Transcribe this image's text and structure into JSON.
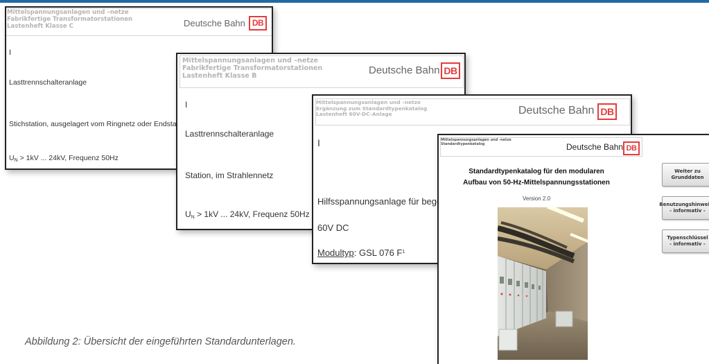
{
  "caption": "Abbildung 2: Übersicht der eingeführten Standardunterlagen.",
  "brand_name": "Deutsche Bahn",
  "logo_text": "DB",
  "doc_c": {
    "header_lines": [
      "Mittelspannungsanlagen und –netze",
      "Fabrikfertige Transformatorstationen",
      "Lastenheft Klasse C"
    ],
    "roman": "I",
    "line1": "Lasttrennschalteranlage",
    "line2": "Stichstation, ausgelagert vom Ringnetz oder Endstation",
    "line3_pre": "U",
    "line3_sub": "N",
    "line3_post": " > 1kV ... 24kV, Frequenz 50Hz"
  },
  "doc_b": {
    "header_lines": [
      "Mittelspannungsanlagen und –netze",
      "Fabrikfertige Transformatorstationen",
      "Lastenheft Klasse B"
    ],
    "roman": "I",
    "line1": "Lasttrennschalteranlage",
    "line2": "Station, im Strahlennetz",
    "line3_pre": "U",
    "line3_sub": "N",
    "line3_post": " > 1kV ... 24kV, Frequenz 50Hz"
  },
  "doc_dc": {
    "header_lines": [
      "Mittelspannungsanlagen und –netze",
      "Ergänzung zum Standardtypenkatalog",
      "Lastenheft 60V-DC-Anlage"
    ],
    "roman": "I",
    "line1": "Hilfsspannungsanlage für begehbare Stationen",
    "line2": "60V DC",
    "line3_label": "Modultyp",
    "line3_value": ": GSL 076 F",
    "line3_sup": "1"
  },
  "doc_cat": {
    "header_lines": [
      "Mittelspannungsanlagen und -netze",
      "Standardtypenkatalog"
    ],
    "title_lines": [
      "Standardtypenkatalog für den modularen",
      "Aufbau von 50-Hz-Mittelspannungsstationen"
    ],
    "version": "Version   2.0",
    "buttons": [
      {
        "line1": "Weiter zu",
        "line2": "Grunddaten"
      },
      {
        "line1": "Benutzungshinweise",
        "line2": "- informativ -"
      },
      {
        "line1": "Typenschlüssel",
        "line2": "- informativ -"
      }
    ]
  }
}
